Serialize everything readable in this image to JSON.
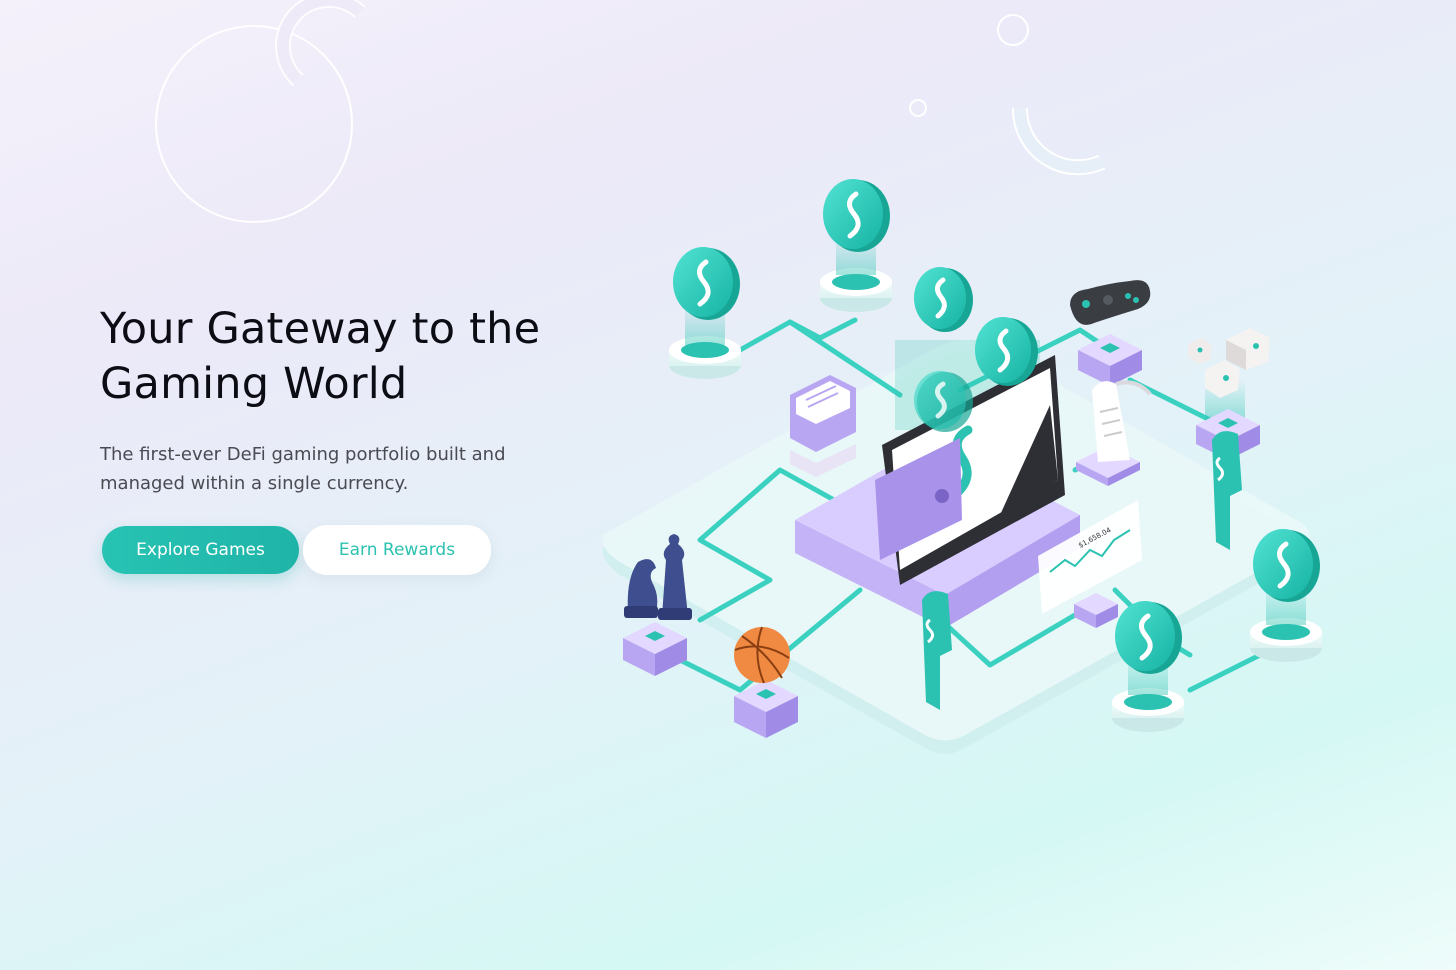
{
  "hero": {
    "headline": "Your Gateway to the Gaming World",
    "subtitle": "The first-ever DeFi gaming portfolio built and managed within a single currency.",
    "primary_cta": "Explore Games",
    "secondary_cta": "Earn Rewards"
  },
  "illustration": {
    "price_label": "$1,658.04"
  },
  "colors": {
    "accent": "#2cc2b1",
    "purple": "#b9a6f2",
    "text": "#0c0c14"
  }
}
